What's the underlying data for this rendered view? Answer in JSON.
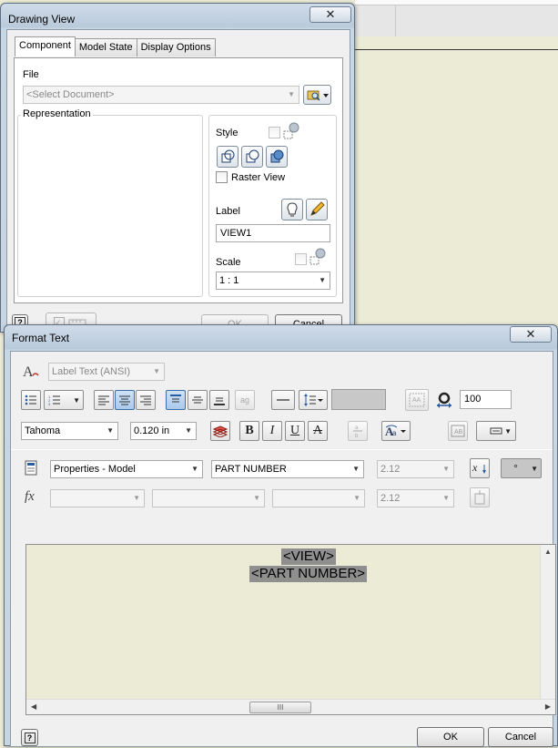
{
  "drawing_view": {
    "title": "Drawing View",
    "close_glyph": "✕",
    "tabs": [
      "Component",
      "Model State",
      "Display Options"
    ],
    "file_label": "File",
    "file_placeholder": "<Select Document>",
    "representation_label": "Representation",
    "style_label": "Style",
    "raster_view_label": "Raster View",
    "label_label": "Label",
    "label_value": "VIEW1",
    "scale_label": "Scale",
    "scale_value": "1 : 1",
    "help_glyph": "?",
    "ok_label": "OK",
    "cancel_label": "Cancel"
  },
  "format_text": {
    "title": "Format Text",
    "close_glyph": "✕",
    "style_value": "Label Text (ANSI)",
    "font_value": "Tahoma",
    "size_value": "0.120 in",
    "width_value": "100",
    "bold": "B",
    "italic": "I",
    "underline": "U",
    "strike": "A",
    "source_value": "Properties - Model",
    "property_value": "PART NUMBER",
    "precision_value": "2.12",
    "precision_value2": "2.12",
    "symbol_value": "°",
    "fx_label": "fx",
    "text_line1": "<VIEW>",
    "text_line2": "<PART NUMBER>",
    "help_glyph": "?",
    "ok_label": "OK",
    "cancel_label": "Cancel",
    "scroll_grip": "III"
  },
  "icons": {
    "browse": "folder-search-icon",
    "style_shaded": "shaded-style-icon",
    "hidden_lines": "hidden-line-icon",
    "pencil": "pencil-icon"
  },
  "colors": {
    "window_frame": "#c7d4e1",
    "client_bg": "#f0f0f0",
    "editor_bg": "#ecebd6",
    "selection_bg": "#8f8f8f",
    "pressed_blue": "#a9c9ec"
  }
}
